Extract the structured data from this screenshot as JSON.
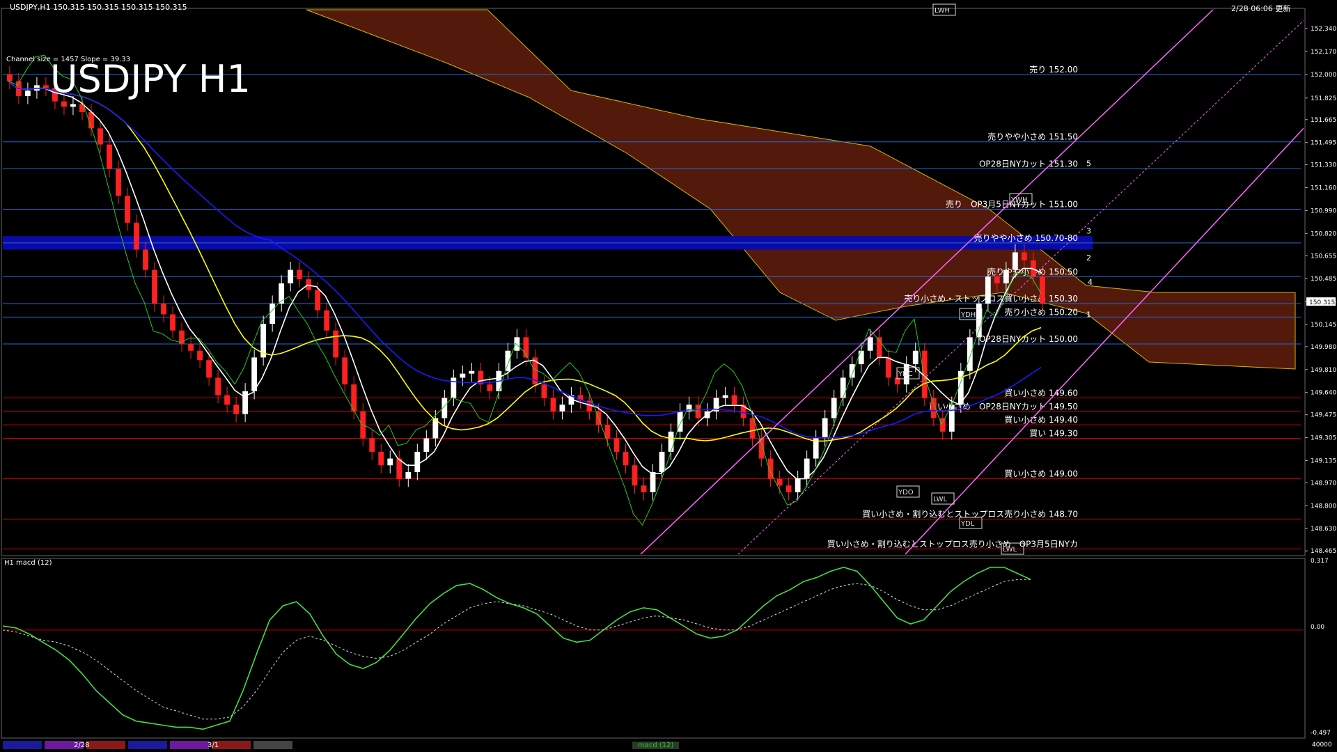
{
  "header": {
    "symbol_line": "USDJPY,H1  150.315 150.315 150.315 150.315",
    "timestamp": "2/28 06:06 更新",
    "channel_info": "Channel size = 1457 Slope = 39.33",
    "title": "USDJPY H1"
  },
  "macd_panel": {
    "label": "H1  macd (12)",
    "ticks": [
      "0.317",
      "0.00",
      "-0.497"
    ]
  },
  "chart_data": [
    {
      "type": "line",
      "panel": "price",
      "y_axis_ticks": [
        "152.340",
        "152.170",
        "152.000",
        "151.825",
        "151.665",
        "151.495",
        "151.330",
        "151.160",
        "150.990",
        "150.820",
        "150.655",
        "150.485",
        "150.315",
        "150.145",
        "149.980",
        "149.810",
        "149.640",
        "149.475",
        "149.305",
        "149.135",
        "148.970",
        "148.800",
        "148.630",
        "148.465"
      ],
      "ylim": [
        148.44,
        152.48
      ],
      "current_price": "150.315",
      "levels": [
        {
          "label": "売り 152.00",
          "y": 152.0,
          "color": "#1e6ad8"
        },
        {
          "label": "売りやや小さめ 151.50",
          "y": 151.5,
          "color": "#1e6ad8"
        },
        {
          "label": "OP28日NYカット 151.30",
          "y": 151.3,
          "color": "#1e6ad8"
        },
        {
          "label": "売り　OP3月5日NYカット 151.00",
          "y": 151.0,
          "color": "#1e6ad8"
        },
        {
          "label": "売りやや小さめ 150.70-80",
          "y": 150.75,
          "color": "#1e6ad8"
        },
        {
          "label": "売りやや小さめ 150.50",
          "y": 150.5,
          "color": "#1e6ad8"
        },
        {
          "label": "売り小さめ・ストップロス買い小さめ 150.30",
          "y": 150.3,
          "color": "#1e6ad8"
        },
        {
          "label": "売り小さめ 150.20",
          "y": 150.2,
          "color": "#1e6ad8"
        },
        {
          "label": "OP28日NYカット 150.00",
          "y": 150.0,
          "color": "#1e6ad8"
        },
        {
          "label": "買い小さめ 149.60",
          "y": 149.6,
          "color": "#d40000"
        },
        {
          "label": "買い小さめ　OP28日NYカット 149.50",
          "y": 149.5,
          "color": "#d40000"
        },
        {
          "label": "買い小さめ 149.40",
          "y": 149.4,
          "color": "#d40000"
        },
        {
          "label": "買い 149.30",
          "y": 149.3,
          "color": "#d40000"
        },
        {
          "label": "買い小さめ 149.00",
          "y": 149.0,
          "color": "#d40000"
        },
        {
          "label": "買い小さめ・割り込むとストップロス売り小さめ 148.70",
          "y": 148.7,
          "color": "#d40000"
        },
        {
          "label": "買い小さめ・割り込むとストップロス売り小さめ　OP3月5日NYカ",
          "y": 148.48,
          "color": "#d40000"
        }
      ],
      "channel_numbers": [
        "1",
        "2",
        "3",
        "4",
        "5"
      ],
      "markers": [
        "LWH",
        "YWH",
        "YDH",
        "YDC",
        "YDO",
        "LWL",
        "YDL",
        "LWL"
      ],
      "candles_close": [
        151.95,
        151.84,
        151.88,
        151.92,
        151.9,
        151.8,
        151.76,
        151.78,
        151.72,
        151.6,
        151.48,
        151.3,
        151.1,
        150.9,
        150.7,
        150.55,
        150.3,
        150.22,
        150.1,
        150.0,
        149.95,
        149.88,
        149.75,
        149.62,
        149.55,
        149.48,
        149.65,
        149.9,
        150.15,
        150.3,
        150.45,
        150.55,
        150.48,
        150.4,
        150.25,
        150.1,
        149.9,
        149.7,
        149.5,
        149.3,
        149.2,
        149.1,
        149.15,
        149.0,
        149.05,
        149.2,
        149.3,
        149.45,
        149.6,
        149.75,
        149.78,
        149.8,
        149.7,
        149.65,
        149.8,
        149.95,
        150.05,
        149.9,
        149.7,
        149.6,
        149.5,
        149.55,
        149.62,
        149.58,
        149.5,
        149.4,
        149.3,
        149.2,
        149.1,
        148.95,
        148.9,
        149.05,
        149.2,
        149.35,
        149.5,
        149.55,
        149.45,
        149.5,
        149.6,
        149.62,
        149.55,
        149.45,
        149.3,
        149.15,
        149.0,
        148.95,
        148.9,
        149.0,
        149.15,
        149.3,
        149.45,
        149.6,
        149.75,
        149.85,
        149.95,
        150.05,
        149.9,
        149.75,
        149.7,
        149.85,
        149.95,
        149.6,
        149.45,
        149.35,
        149.55,
        149.8,
        150.05,
        150.3,
        150.5,
        150.45,
        150.55,
        150.68,
        150.62,
        150.5,
        150.3
      ]
    },
    {
      "type": "line",
      "panel": "macd",
      "ylim": [
        -0.52,
        0.34
      ],
      "series": [
        {
          "values": [
            0.02,
            0.01,
            -0.02,
            -0.06,
            -0.1,
            -0.15,
            -0.22,
            -0.3,
            -0.36,
            -0.42,
            -0.45,
            -0.46,
            -0.47,
            -0.48,
            -0.48,
            -0.49,
            -0.47,
            -0.45,
            -0.3,
            -0.12,
            0.05,
            0.12,
            0.14,
            0.08,
            -0.03,
            -0.12,
            -0.17,
            -0.19,
            -0.16,
            -0.1,
            -0.02,
            0.06,
            0.13,
            0.18,
            0.22,
            0.23,
            0.2,
            0.16,
            0.13,
            0.11,
            0.08,
            0.02,
            -0.04,
            -0.06,
            -0.05,
            0.0,
            0.05,
            0.09,
            0.11,
            0.1,
            0.06,
            0.02,
            -0.02,
            -0.04,
            -0.03,
            0.0,
            0.06,
            0.12,
            0.17,
            0.2,
            0.24,
            0.26,
            0.29,
            0.31,
            0.29,
            0.22,
            0.14,
            0.06,
            0.03,
            0.05,
            0.12,
            0.19,
            0.24,
            0.28,
            0.31,
            0.31,
            0.28,
            0.25
          ]
        },
        {
          "values": [
            0.0,
            -0.01,
            -0.03,
            -0.05,
            -0.06,
            -0.08,
            -0.11,
            -0.15,
            -0.2,
            -0.25,
            -0.3,
            -0.34,
            -0.38,
            -0.4,
            -0.42,
            -0.44,
            -0.44,
            -0.43,
            -0.38,
            -0.3,
            -0.2,
            -0.11,
            -0.05,
            -0.03,
            -0.05,
            -0.08,
            -0.11,
            -0.13,
            -0.14,
            -0.13,
            -0.1,
            -0.06,
            -0.02,
            0.03,
            0.07,
            0.11,
            0.13,
            0.14,
            0.13,
            0.12,
            0.1,
            0.08,
            0.05,
            0.02,
            0.0,
            0.0,
            0.02,
            0.04,
            0.06,
            0.07,
            0.06,
            0.05,
            0.03,
            0.01,
            0.0,
            0.0,
            0.02,
            0.05,
            0.08,
            0.11,
            0.14,
            0.17,
            0.2,
            0.22,
            0.23,
            0.22,
            0.19,
            0.15,
            0.12,
            0.1,
            0.1,
            0.12,
            0.15,
            0.18,
            0.21,
            0.24,
            0.25,
            0.25
          ]
        }
      ]
    }
  ],
  "footer": {
    "date_labels": [
      "2/28",
      "3/1"
    ],
    "button_label": "macd (12)",
    "corner_value": "40000"
  },
  "colors": {
    "buy_line": "#d40000",
    "sell_line": "#1e6ad8",
    "cloud": "#b83a1a",
    "channel": "#ff66ff",
    "ma_yellow": "#ffff00",
    "ma_white": "#ffffff",
    "ma_blue": "#1a1aff",
    "chikou": "#22cc22"
  }
}
